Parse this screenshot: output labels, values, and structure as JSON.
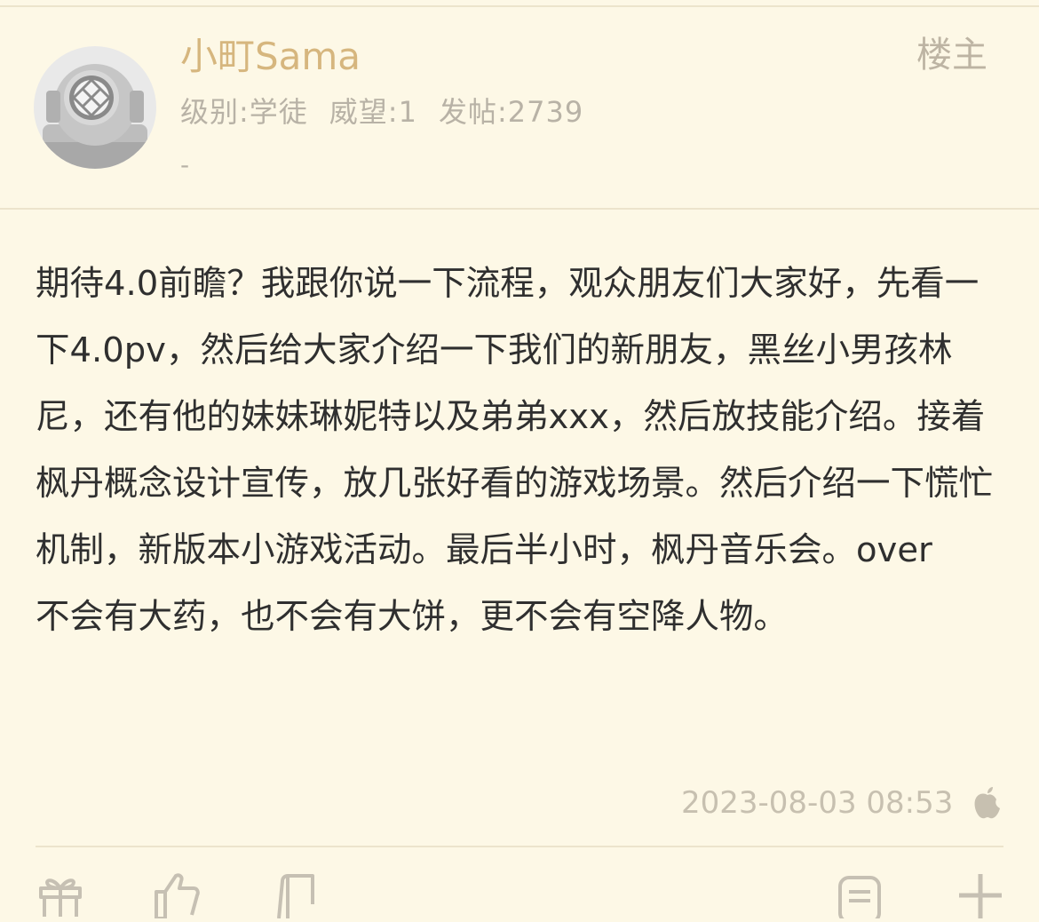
{
  "post": {
    "author": {
      "name": "小町Sama",
      "level": "级别:学徒",
      "prestige": "威望:1",
      "posts": "发帖:2739",
      "signature": "-",
      "avatar_icon": "diving-helmet-icon"
    },
    "op_badge": "楼主",
    "content": "期待4.0前瞻？我跟你说一下流程，观众朋友们大家好，先看一下4.0pv，然后给大家介绍一下我们的新朋友，黑丝小男孩林尼，还有他的妹妹琳妮特以及弟弟xxx，然后放技能介绍。接着枫丹概念设计宣传，放几张好看的游戏场景。然后介绍一下慌忙机制，新版本小游戏活动。最后半小时，枫丹音乐会。over\n不会有大药，也不会有大饼，更不会有空降人物。",
    "timestamp": "2023-08-03 08:53",
    "device_icon": "apple-icon"
  },
  "actions": {
    "icons": [
      "gift-icon",
      "like-icon",
      "dislike-icon",
      "reply-icon",
      "add-icon"
    ]
  },
  "colors": {
    "background": "#fdf8e6",
    "username": "#d6b67e",
    "text": "#2f2f2f",
    "muted": "#b8b2a6",
    "divider": "#ece4cc"
  }
}
